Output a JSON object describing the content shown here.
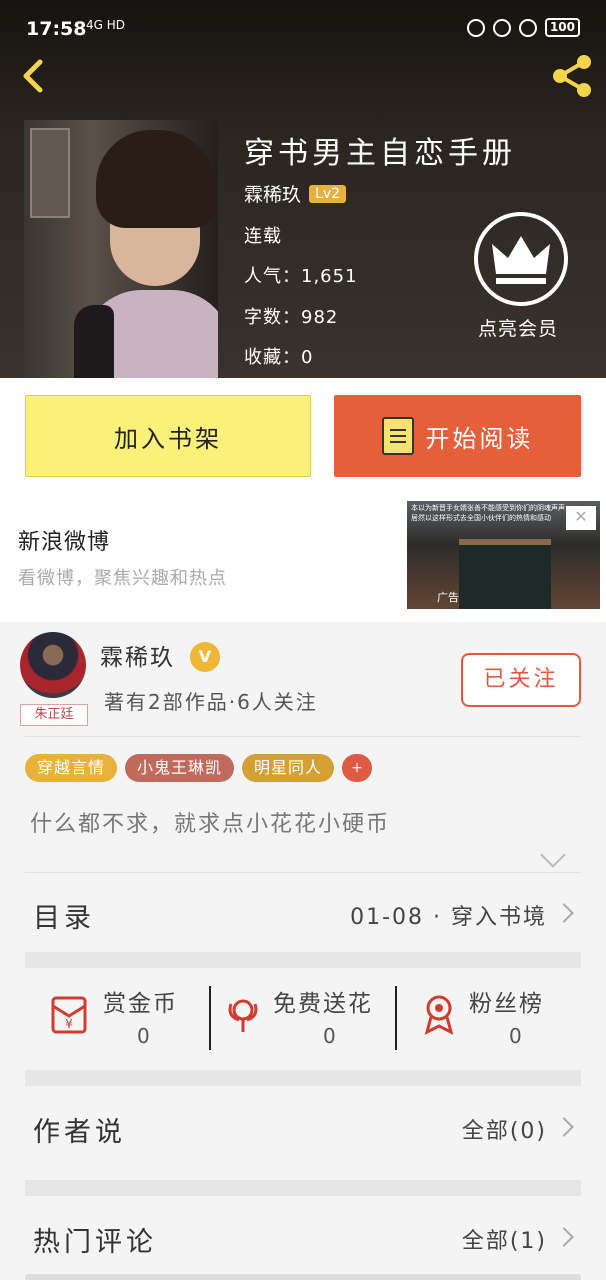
{
  "status_bar": {
    "time": "17:58",
    "network": "4G HD",
    "battery": "100"
  },
  "book": {
    "title": "穿书男主自恋手册",
    "author": "霖稀玖",
    "level": "Lv2",
    "status": "连载",
    "popularity": "人气：1,651",
    "word_count": "字数：982",
    "favorites": "收藏：0"
  },
  "vip": {
    "label": "点亮会员"
  },
  "actions": {
    "add_shelf": "加入书架",
    "start_reading": "开始阅读"
  },
  "ad": {
    "title": "新浪微博",
    "subtitle": "看微博，聚焦兴趣和热点",
    "image_caption": "本以为新晋手女婿张善不能感受到你们的阴魂声声，居然以这样形式去全国小伙伴们的热情和感动",
    "tag": "广告"
  },
  "author_card": {
    "name": "霖稀玖",
    "badge": "V",
    "avatar_tag": "朱正廷",
    "stats": "著有2部作品·6人关注",
    "follow_label": "已关注",
    "tags": [
      {
        "label": "穿越言情",
        "color": "#e8b23a"
      },
      {
        "label": "小鬼王琳凯",
        "color": "#c06a5c"
      },
      {
        "label": "明星同人",
        "color": "#d4a034"
      }
    ],
    "add_tag": "+",
    "motto": "什么都不求，就求点小花花小硬币"
  },
  "catalog": {
    "label": "目录",
    "value": "01-08 · 穿入书境"
  },
  "gifts": [
    {
      "label": "赏金币",
      "count": "0",
      "icon": "red-envelope-icon"
    },
    {
      "label": "免费送花",
      "count": "0",
      "icon": "flower-icon"
    },
    {
      "label": "粉丝榜",
      "count": "0",
      "icon": "medal-icon"
    }
  ],
  "author_says": {
    "label": "作者说",
    "value": "全部(0)"
  },
  "hot_comments": {
    "label": "热门评论",
    "value": "全部(1)"
  },
  "colors": {
    "accent": "#e05a43",
    "shelf_button": "#fbf079",
    "read_button": "#e5603a",
    "vip_gold": "#f0b638"
  }
}
